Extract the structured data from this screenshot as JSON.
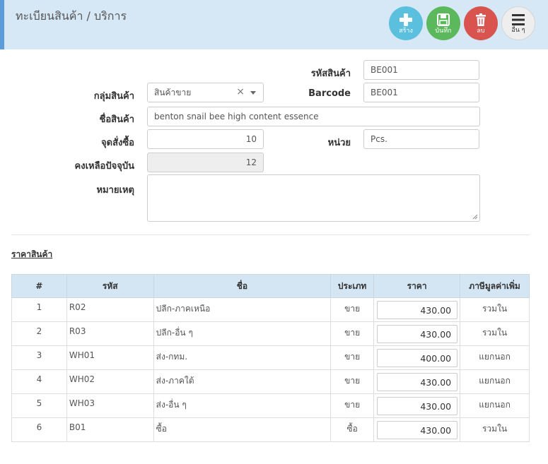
{
  "header": {
    "title": "ทะเบียนสินค้า / บริการ",
    "actions": [
      {
        "label": "สร้าง",
        "icon": "plus-icon"
      },
      {
        "label": "บันทึก",
        "icon": "save-icon"
      },
      {
        "label": "ลบ",
        "icon": "trash-icon"
      },
      {
        "label": "อื่น ๆ",
        "icon": "menu-icon"
      }
    ]
  },
  "form": {
    "code_label": "รหัสสินค้า",
    "code_value": "BE001",
    "group_label": "กลุ่มสินค้า",
    "group_value": "สินค้าขาย",
    "barcode_label": "Barcode",
    "barcode_value": "BE001",
    "name_label": "ชื่อสินค้า",
    "name_value": "benton snail bee high content essence",
    "reorder_label": "จุดสั่งซื้อ",
    "reorder_value": "10",
    "unit_label": "หน่วย",
    "unit_value": "Pcs.",
    "stock_label": "คงเหลือปัจจุบัน",
    "stock_value": "12",
    "note_label": "หมายเหตุ",
    "note_value": ""
  },
  "price_section": {
    "title": "ราคาสินค้า",
    "columns": [
      "#",
      "รหัส",
      "ชื่อ",
      "ประเภท",
      "ราคา",
      "ภาษีมูลค่าเพิ่ม"
    ],
    "rows": [
      {
        "no": "1",
        "code": "R02",
        "name": "ปลีก-ภาคเหนือ",
        "type": "ขาย",
        "price": "430.00",
        "vat": "รวมใน"
      },
      {
        "no": "2",
        "code": "R03",
        "name": "ปลีก-อื่น ๆ",
        "type": "ขาย",
        "price": "430.00",
        "vat": "รวมใน"
      },
      {
        "no": "3",
        "code": "WH01",
        "name": "ส่ง-กทม.",
        "type": "ขาย",
        "price": "400.00",
        "vat": "แยกนอก"
      },
      {
        "no": "4",
        "code": "WH02",
        "name": "ส่ง-ภาคใต้",
        "type": "ขาย",
        "price": "430.00",
        "vat": "แยกนอก"
      },
      {
        "no": "5",
        "code": "WH03",
        "name": "ส่ง-อื่น ๆ",
        "type": "ขาย",
        "price": "430.00",
        "vat": "แยกนอก"
      },
      {
        "no": "6",
        "code": "B01",
        "name": "ซื้อ",
        "type": "ซื้อ",
        "price": "430.00",
        "vat": "รวมใน"
      }
    ]
  }
}
